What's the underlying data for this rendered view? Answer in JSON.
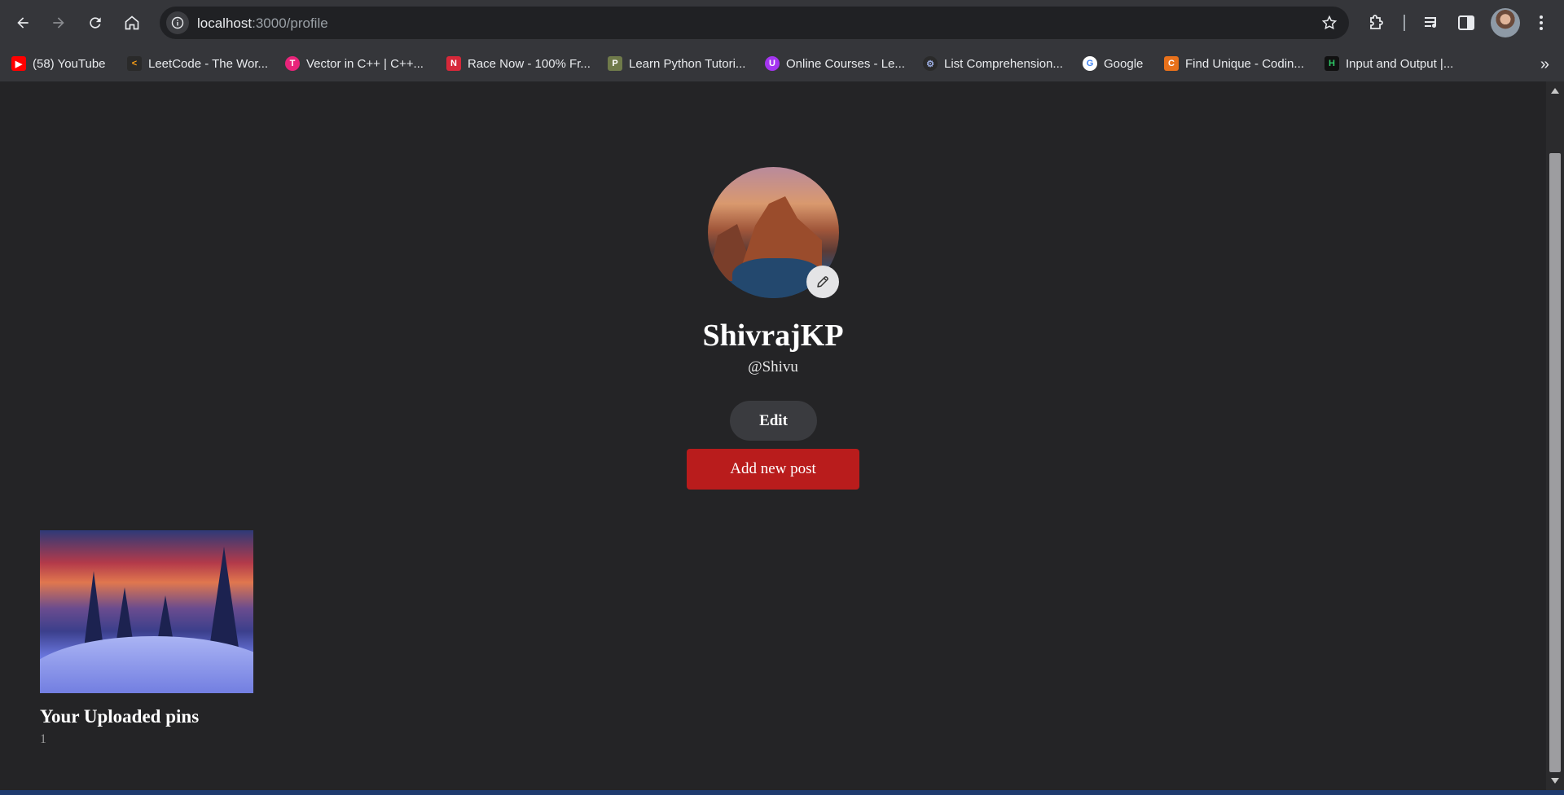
{
  "browser": {
    "url_host": "localhost",
    "url_path": ":3000/profile",
    "bookmarks": [
      {
        "label": "(58) YouTube",
        "icon": "youtube-icon",
        "color": "#ff0000"
      },
      {
        "label": "LeetCode - The Wor...",
        "icon": "leetcode-icon",
        "color": "#ffa116"
      },
      {
        "label": "Vector in C++ | C++...",
        "icon": "scaler-icon",
        "color": "#e8247a"
      },
      {
        "label": "Race Now - 100% Fr...",
        "icon": "nitrotype-icon",
        "color": "#d62839"
      },
      {
        "label": "Learn Python Tutori...",
        "icon": "python-tutorial-icon",
        "color": "#9aa86a"
      },
      {
        "label": "Online Courses - Le...",
        "icon": "udemy-icon",
        "color": "#a435f0"
      },
      {
        "label": "List Comprehension...",
        "icon": "gear-site-icon",
        "color": "#2a2a2a"
      },
      {
        "label": "Google",
        "icon": "google-icon",
        "color": "#ffffff"
      },
      {
        "label": "Find Unique - Codin...",
        "icon": "codechef-icon",
        "color": "#e8711b"
      },
      {
        "label": "Input and Output |...",
        "icon": "hackerrank-icon",
        "color": "#111111"
      }
    ]
  },
  "profile": {
    "name": "ShivrajKP",
    "handle": "@Shivu",
    "edit_label": "Edit",
    "add_post_label": "Add new post"
  },
  "pins": {
    "title": "Your Uploaded pins",
    "count": "1"
  },
  "colors": {
    "page_bg": "#242426",
    "accent_red": "#b91c1c",
    "edit_button_bg": "#3a3b3f"
  }
}
